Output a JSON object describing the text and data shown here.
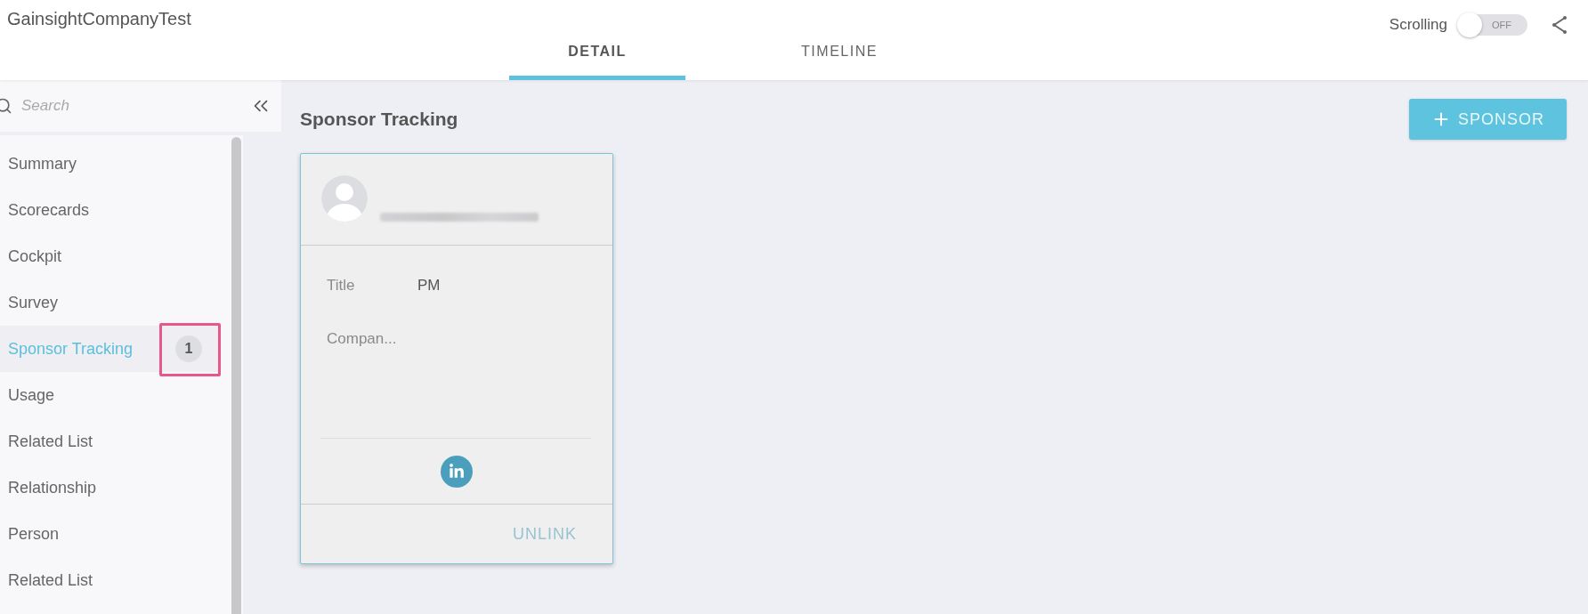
{
  "header": {
    "title": "GainsightCompanyTest",
    "tabs": [
      {
        "label": "DETAIL",
        "selected": true
      },
      {
        "label": "TIMELINE",
        "selected": false
      }
    ],
    "scrolling": {
      "label": "Scrolling",
      "on": false,
      "state_text": "OFF"
    }
  },
  "sidebar": {
    "search": {
      "placeholder": "Search"
    },
    "items": [
      {
        "label": "Summary",
        "selected": false,
        "annotated": false
      },
      {
        "label": "Scorecards",
        "selected": false,
        "annotated": false
      },
      {
        "label": "Cockpit",
        "selected": false,
        "annotated": false
      },
      {
        "label": "Survey",
        "selected": false,
        "annotated": false
      },
      {
        "label": "Sponsor Tracking",
        "selected": true,
        "annotated": true,
        "badge": "1"
      },
      {
        "label": "Usage",
        "selected": false,
        "annotated": false
      },
      {
        "label": "Related List",
        "selected": false,
        "annotated": false
      },
      {
        "label": "Relationship",
        "selected": false,
        "annotated": false
      },
      {
        "label": "Person",
        "selected": false,
        "annotated": false
      },
      {
        "label": "Related List",
        "selected": false,
        "annotated": false
      }
    ]
  },
  "main": {
    "heading": "Sponsor Tracking",
    "add_button": {
      "label": "SPONSOR"
    },
    "sponsor_cards": [
      {
        "fields": [
          {
            "label": "Title",
            "value": "PM"
          },
          {
            "label": "Compan..."
          }
        ],
        "unlink": {
          "label": "UNLINK",
          "disabled": true
        }
      }
    ]
  }
}
